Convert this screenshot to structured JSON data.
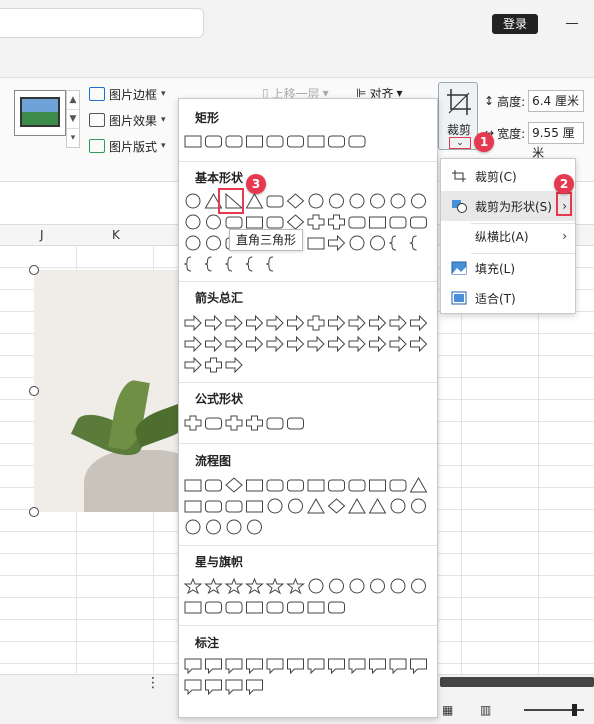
{
  "titlebar": {
    "login_label": "登录"
  },
  "ribbon": {
    "picture_border": "图片边框",
    "picture_effect": "图片效果",
    "picture_style": "图片版式",
    "move_up": "上移一层",
    "align": "对齐",
    "crop_label": "裁剪",
    "height_label": "高度:",
    "height_value": "6.4 厘米",
    "width_label": "宽度:",
    "width_value": "9.55 厘米"
  },
  "sheet": {
    "col_j": "J",
    "col_k": "K"
  },
  "shapes_panel": {
    "sections": [
      {
        "title": "矩形"
      },
      {
        "title": "基本形状"
      },
      {
        "title": "箭头总汇"
      },
      {
        "title": "公式形状"
      },
      {
        "title": "流程图"
      },
      {
        "title": "星与旗帜"
      },
      {
        "title": "标注"
      }
    ],
    "tooltip": "直角三角形"
  },
  "crop_menu": {
    "items": [
      {
        "label": "裁剪(C)"
      },
      {
        "label": "裁剪为形状(S)"
      },
      {
        "label": "纵横比(A)"
      },
      {
        "label": "填充(L)"
      },
      {
        "label": "适合(T)"
      }
    ]
  },
  "badges": {
    "step1": "1",
    "step2": "2",
    "step3": "3"
  },
  "colors": {
    "badge": "#e53950",
    "highlight": "#e53950"
  }
}
